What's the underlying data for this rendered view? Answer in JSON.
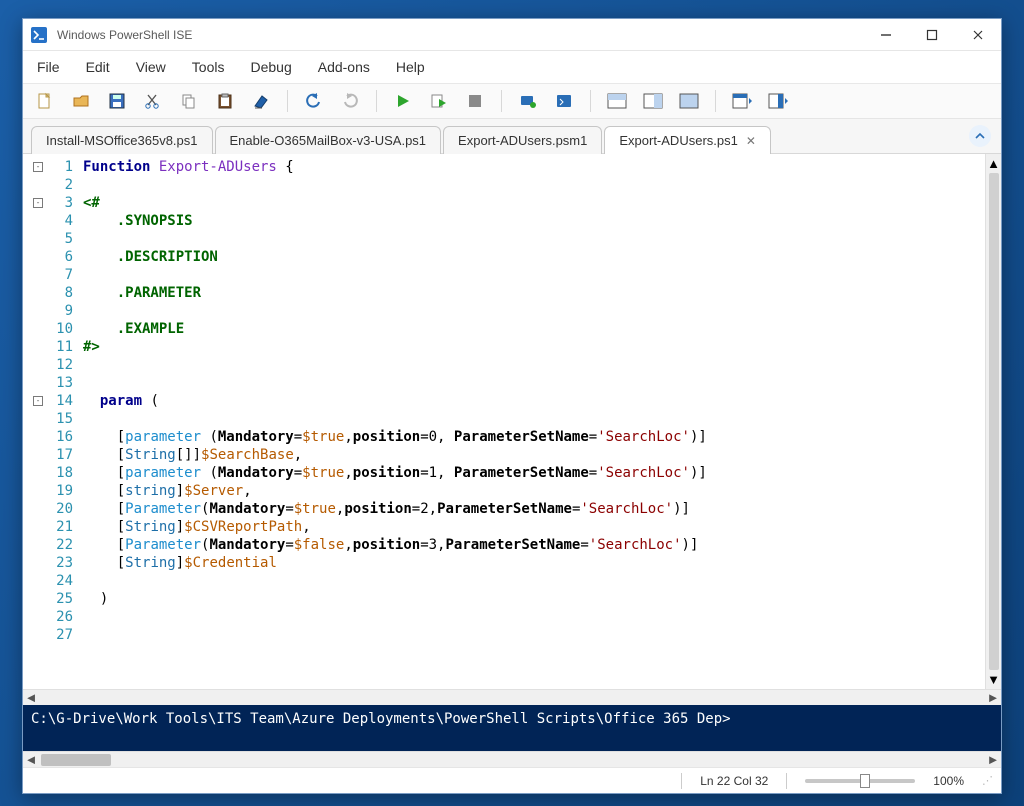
{
  "window": {
    "title": "Windows PowerShell ISE"
  },
  "menu": {
    "items": [
      "File",
      "Edit",
      "View",
      "Tools",
      "Debug",
      "Add-ons",
      "Help"
    ]
  },
  "toolbar": {
    "buttons": [
      "new-icon",
      "open-icon",
      "save-icon",
      "cut-icon",
      "copy-icon",
      "paste-icon",
      "clear-icon",
      "undo-icon",
      "redo-icon",
      "run-icon",
      "run-selection-icon",
      "stop-icon",
      "remote-icon",
      "new-remote-icon",
      "show-script-top-icon",
      "show-script-right-icon",
      "show-script-max-icon",
      "show-command-icon",
      "show-command-addon-icon"
    ]
  },
  "tabs": {
    "items": [
      {
        "label": "Install-MSOffice365v8.ps1",
        "active": false,
        "closeable": false
      },
      {
        "label": "Enable-O365MailBox-v3-USA.ps1",
        "active": false,
        "closeable": false
      },
      {
        "label": "Export-ADUsers.psm1",
        "active": false,
        "closeable": false
      },
      {
        "label": "Export-ADUsers.ps1",
        "active": true,
        "closeable": true
      }
    ]
  },
  "code": {
    "lines": [
      {
        "n": 1,
        "fold": "-",
        "tokens": [
          {
            "c": "t-kw",
            "t": "Function "
          },
          {
            "c": "t-cmdlet",
            "t": "Export-ADUsers"
          },
          {
            "c": "t-plain",
            "t": " {"
          }
        ]
      },
      {
        "n": 2,
        "tokens": []
      },
      {
        "n": 3,
        "fold": "-",
        "tokens": [
          {
            "c": "t-com",
            "t": "<#"
          }
        ]
      },
      {
        "n": 4,
        "tokens": [
          {
            "c": "t-plain",
            "t": "    "
          },
          {
            "c": "t-com",
            "t": ".SYNOPSIS"
          }
        ]
      },
      {
        "n": 5,
        "tokens": []
      },
      {
        "n": 6,
        "tokens": [
          {
            "c": "t-plain",
            "t": "    "
          },
          {
            "c": "t-com",
            "t": ".DESCRIPTION"
          }
        ]
      },
      {
        "n": 7,
        "tokens": []
      },
      {
        "n": 8,
        "tokens": [
          {
            "c": "t-plain",
            "t": "    "
          },
          {
            "c": "t-com",
            "t": ".PARAMETER"
          }
        ]
      },
      {
        "n": 9,
        "tokens": []
      },
      {
        "n": 10,
        "tokens": [
          {
            "c": "t-plain",
            "t": "    "
          },
          {
            "c": "t-com",
            "t": ".EXAMPLE"
          }
        ]
      },
      {
        "n": 11,
        "tokens": [
          {
            "c": "t-com",
            "t": "#>"
          }
        ]
      },
      {
        "n": 12,
        "tokens": []
      },
      {
        "n": 13,
        "tokens": []
      },
      {
        "n": 14,
        "fold": "-",
        "tokens": [
          {
            "c": "t-plain",
            "t": "  "
          },
          {
            "c": "t-kw",
            "t": "param"
          },
          {
            "c": "t-plain",
            "t": " ("
          }
        ]
      },
      {
        "n": 15,
        "tokens": []
      },
      {
        "n": 16,
        "tokens": [
          {
            "c": "t-plain",
            "t": "    ["
          },
          {
            "c": "t-attr",
            "t": "parameter"
          },
          {
            "c": "t-plain",
            "t": " ("
          },
          {
            "c": "t-named",
            "t": "Mandatory"
          },
          {
            "c": "t-plain",
            "t": "="
          },
          {
            "c": "t-var",
            "t": "$true"
          },
          {
            "c": "t-plain",
            "t": ","
          },
          {
            "c": "t-named",
            "t": "position"
          },
          {
            "c": "t-plain",
            "t": "=0, "
          },
          {
            "c": "t-named",
            "t": "ParameterSetName"
          },
          {
            "c": "t-plain",
            "t": "="
          },
          {
            "c": "t-str",
            "t": "'SearchLoc'"
          },
          {
            "c": "t-plain",
            "t": ")]"
          }
        ]
      },
      {
        "n": 17,
        "tokens": [
          {
            "c": "t-plain",
            "t": "    ["
          },
          {
            "c": "t-type",
            "t": "String"
          },
          {
            "c": "t-plain",
            "t": "[]]"
          },
          {
            "c": "t-var",
            "t": "$SearchBase"
          },
          {
            "c": "t-plain",
            "t": ","
          }
        ]
      },
      {
        "n": 18,
        "tokens": [
          {
            "c": "t-plain",
            "t": "    ["
          },
          {
            "c": "t-attr",
            "t": "parameter"
          },
          {
            "c": "t-plain",
            "t": " ("
          },
          {
            "c": "t-named",
            "t": "Mandatory"
          },
          {
            "c": "t-plain",
            "t": "="
          },
          {
            "c": "t-var",
            "t": "$true"
          },
          {
            "c": "t-plain",
            "t": ","
          },
          {
            "c": "t-named",
            "t": "position"
          },
          {
            "c": "t-plain",
            "t": "=1, "
          },
          {
            "c": "t-named",
            "t": "ParameterSetName"
          },
          {
            "c": "t-plain",
            "t": "="
          },
          {
            "c": "t-str",
            "t": "'SearchLoc'"
          },
          {
            "c": "t-plain",
            "t": ")]"
          }
        ]
      },
      {
        "n": 19,
        "tokens": [
          {
            "c": "t-plain",
            "t": "    ["
          },
          {
            "c": "t-type",
            "t": "string"
          },
          {
            "c": "t-plain",
            "t": "]"
          },
          {
            "c": "t-var",
            "t": "$Server"
          },
          {
            "c": "t-plain",
            "t": ","
          }
        ]
      },
      {
        "n": 20,
        "tokens": [
          {
            "c": "t-plain",
            "t": "    ["
          },
          {
            "c": "t-attr",
            "t": "Parameter"
          },
          {
            "c": "t-plain",
            "t": "("
          },
          {
            "c": "t-named",
            "t": "Mandatory"
          },
          {
            "c": "t-plain",
            "t": "="
          },
          {
            "c": "t-var",
            "t": "$true"
          },
          {
            "c": "t-plain",
            "t": ","
          },
          {
            "c": "t-named",
            "t": "position"
          },
          {
            "c": "t-plain",
            "t": "=2,"
          },
          {
            "c": "t-named",
            "t": "ParameterSetName"
          },
          {
            "c": "t-plain",
            "t": "="
          },
          {
            "c": "t-str",
            "t": "'SearchLoc'"
          },
          {
            "c": "t-plain",
            "t": ")]"
          }
        ]
      },
      {
        "n": 21,
        "tokens": [
          {
            "c": "t-plain",
            "t": "    ["
          },
          {
            "c": "t-type",
            "t": "String"
          },
          {
            "c": "t-plain",
            "t": "]"
          },
          {
            "c": "t-var",
            "t": "$CSVReportPath"
          },
          {
            "c": "t-plain",
            "t": ","
          }
        ]
      },
      {
        "n": 22,
        "tokens": [
          {
            "c": "t-plain",
            "t": "    ["
          },
          {
            "c": "t-attr",
            "t": "Parameter"
          },
          {
            "c": "t-plain",
            "t": "("
          },
          {
            "c": "t-named",
            "t": "Mandatory"
          },
          {
            "c": "t-plain",
            "t": "="
          },
          {
            "c": "t-var",
            "t": "$false"
          },
          {
            "c": "t-plain",
            "t": ","
          },
          {
            "c": "t-named",
            "t": "position"
          },
          {
            "c": "t-plain",
            "t": "=3,"
          },
          {
            "c": "t-named",
            "t": "ParameterSetName"
          },
          {
            "c": "t-plain",
            "t": "="
          },
          {
            "c": "t-str",
            "t": "'SearchLoc'"
          },
          {
            "c": "t-plain",
            "t": ")]"
          }
        ]
      },
      {
        "n": 23,
        "tokens": [
          {
            "c": "t-plain",
            "t": "    ["
          },
          {
            "c": "t-type",
            "t": "String"
          },
          {
            "c": "t-plain",
            "t": "]"
          },
          {
            "c": "t-var",
            "t": "$Credential"
          }
        ]
      },
      {
        "n": 24,
        "tokens": []
      },
      {
        "n": 25,
        "tokens": [
          {
            "c": "t-plain",
            "t": "  )"
          }
        ]
      },
      {
        "n": 26,
        "tokens": []
      },
      {
        "n": 27,
        "tokens": []
      }
    ]
  },
  "console": {
    "prompt": "C:\\G-Drive\\Work Tools\\ITS Team\\Azure Deployments\\PowerShell Scripts\\Office 365 Dep>"
  },
  "status": {
    "pos": "Ln 22  Col 32",
    "zoom": "100%"
  }
}
